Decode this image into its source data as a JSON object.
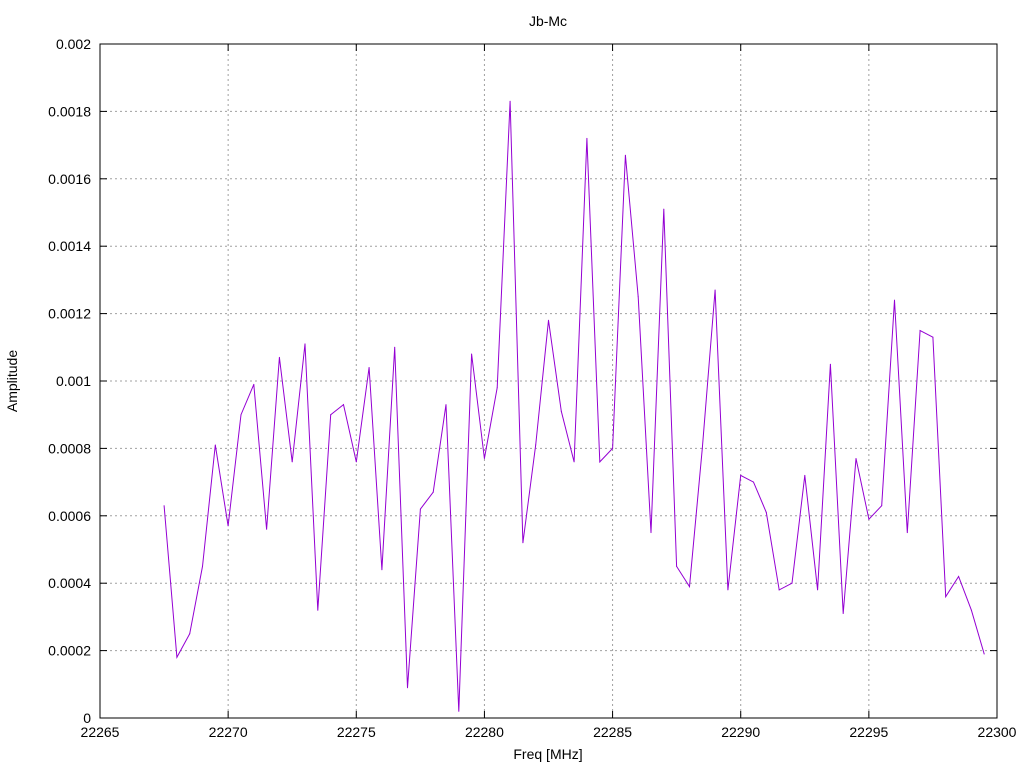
{
  "chart_data": {
    "type": "line",
    "title": "Jb-Mc",
    "xlabel": "Freq [MHz]",
    "ylabel": "Amplitude",
    "xlim": [
      22265,
      22300
    ],
    "ylim": [
      0,
      0.002
    ],
    "xticks": [
      "22265",
      "22270",
      "22275",
      "22280",
      "22285",
      "22290",
      "22295",
      "22300"
    ],
    "yticks": [
      "0",
      "0.0002",
      "0.0004",
      "0.0006",
      "0.0008",
      "0.001",
      "0.0012",
      "0.0014",
      "0.0016",
      "0.0018",
      "0.002"
    ],
    "grid": true,
    "series": [
      {
        "color": "#9400d3",
        "x": [
          22267.5,
          22268.0,
          22268.5,
          22269.0,
          22269.5,
          22270.0,
          22270.5,
          22271.0,
          22271.5,
          22272.0,
          22272.5,
          22273.0,
          22273.5,
          22274.0,
          22274.5,
          22275.0,
          22275.5,
          22276.0,
          22276.5,
          22277.0,
          22277.5,
          22278.0,
          22278.5,
          22279.0,
          22279.5,
          22280.0,
          22280.5,
          22281.0,
          22281.5,
          22282.0,
          22282.5,
          22283.0,
          22283.5,
          22284.0,
          22284.5,
          22285.0,
          22285.5,
          22286.0,
          22286.5,
          22287.0,
          22287.5,
          22288.0,
          22288.5,
          22289.0,
          22289.5,
          22290.0,
          22290.5,
          22291.0,
          22291.5,
          22292.0,
          22292.5,
          22293.0,
          22293.5,
          22294.0,
          22294.5,
          22295.0,
          22295.5,
          22296.0,
          22296.5,
          22297.0,
          22297.5,
          22298.0,
          22298.5,
          22299.0,
          22299.5
        ],
        "y": [
          0.00063,
          0.00018,
          0.00025,
          0.00045,
          0.00081,
          0.00057,
          0.0009,
          0.00099,
          0.00056,
          0.00107,
          0.00076,
          0.00111,
          0.00032,
          0.0009,
          0.00093,
          0.00076,
          0.00104,
          0.00044,
          0.0011,
          9e-05,
          0.00062,
          0.00067,
          0.00093,
          2e-05,
          0.00108,
          0.00077,
          0.00098,
          0.00183,
          0.00052,
          0.00081,
          0.00118,
          0.00091,
          0.00076,
          0.00172,
          0.00076,
          0.0008,
          0.00167,
          0.00125,
          0.00055,
          0.00151,
          0.00045,
          0.00039,
          0.0008,
          0.00127,
          0.00038,
          0.00072,
          0.0007,
          0.00061,
          0.00038,
          0.0004,
          0.00072,
          0.00038,
          0.00105,
          0.00031,
          0.00077,
          0.00059,
          0.00063,
          0.00124,
          0.00055,
          0.00115,
          0.00113,
          0.00036,
          0.00042,
          0.00032,
          0.00019
        ]
      }
    ]
  }
}
